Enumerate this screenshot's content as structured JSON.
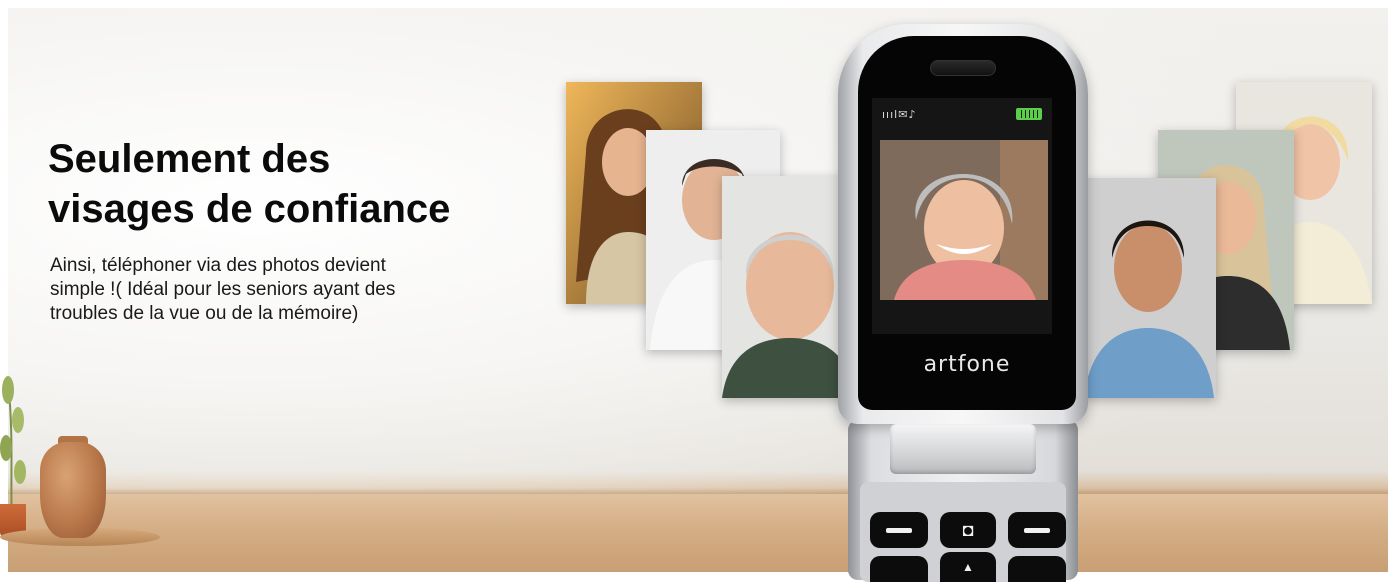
{
  "headline": {
    "line1": "Seulement des",
    "line2": "visages de confiance"
  },
  "subtext": {
    "line1": "Ainsi, téléphoner via des photos devient",
    "line2": "simple !( Idéal pour les seniors ayant des",
    "line3": "troubles de la vue ou de la mémoire)"
  },
  "phone": {
    "brand": "artfone",
    "status_icons": "ıııl✉♪",
    "camera_key_glyph": "◘",
    "up_key_glyph": "▲"
  },
  "colors": {
    "battery": "#5ad04a",
    "phone_face": "#050505",
    "table_wood": "#d4ae86",
    "headline_text": "#0b0b0b"
  },
  "icons": [
    "signal-icon",
    "message-icon",
    "music-icon",
    "battery-icon",
    "camera-icon"
  ]
}
